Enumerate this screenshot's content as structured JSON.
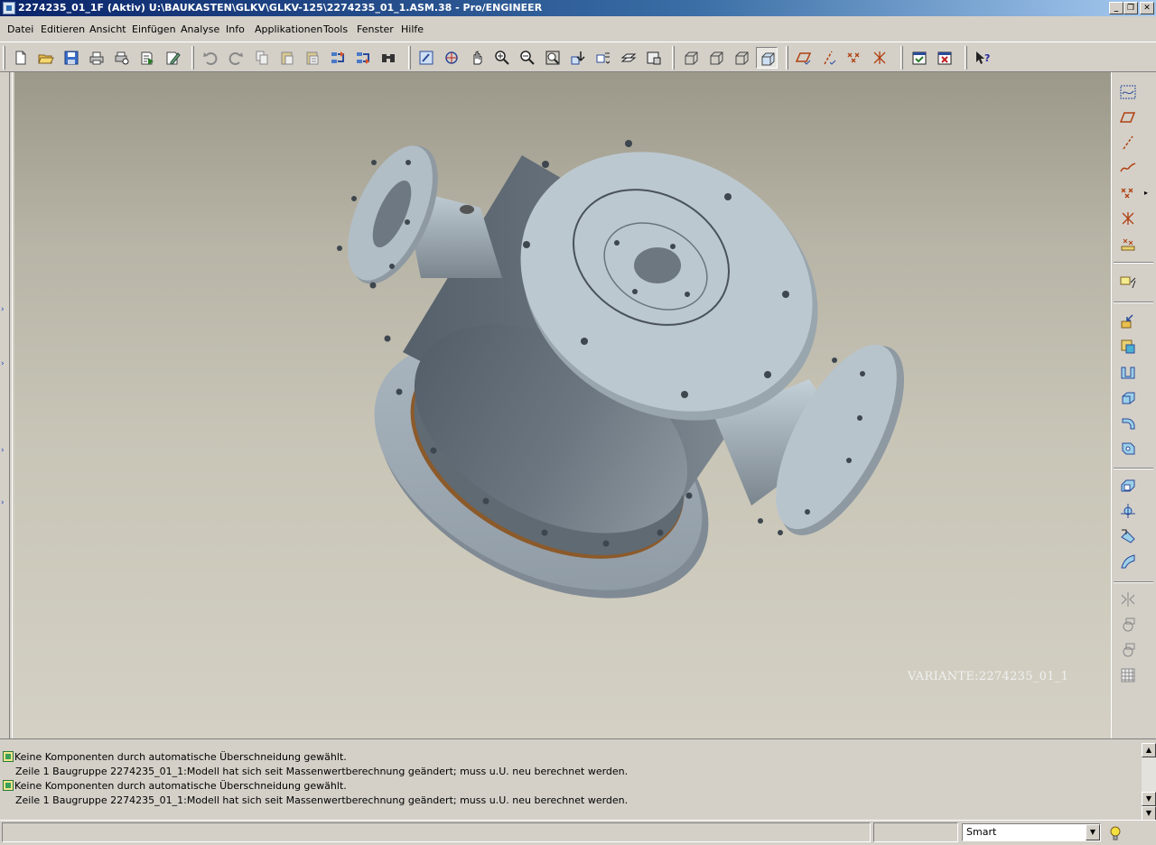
{
  "window": {
    "title": "2274235_01_1F (Aktiv) U:\\BAUKASTEN\\GLKV\\GLKV-125\\2274235_01_1.ASM.38 - Pro/ENGINEER",
    "controls": {
      "minimize": "_",
      "restore": "❐",
      "close": "✕"
    }
  },
  "menu": {
    "items": [
      {
        "label": "Datei"
      },
      {
        "label": "Editieren"
      },
      {
        "label": "Ansicht"
      },
      {
        "label": "Einfügen"
      },
      {
        "label": "Analyse"
      },
      {
        "label": "Info"
      },
      {
        "label": "Applikationen"
      },
      {
        "label": "Tools"
      },
      {
        "label": "Fenster"
      },
      {
        "label": "Hilfe"
      }
    ]
  },
  "toolbar": {
    "icons": [
      "new-file-icon",
      "open-file-icon",
      "save-icon",
      "print-icon",
      "print-preview-icon",
      "send-mail-icon",
      "edit-mail-icon",
      "undo-icon",
      "redo-icon",
      "copy-icon",
      "paste-icon",
      "paste-special-icon",
      "regenerate-icon",
      "regenerate-manager-icon",
      "find-icon",
      "repaint-icon",
      "spin-center-icon",
      "pan-icon",
      "zoom-in-icon",
      "zoom-out-icon",
      "refit-icon",
      "reorient-icon",
      "saved-views-icon",
      "layers-icon",
      "model-setup-icon",
      "wireframe-icon",
      "hidden-line-icon",
      "no-hidden-icon",
      "shading-icon",
      "datum-planes-icon",
      "datum-axes-icon",
      "datum-points-icon",
      "coordinate-systems-icon",
      "window-activate-icon",
      "window-close-icon",
      "context-help-icon"
    ]
  },
  "right_toolbar": {
    "icons": [
      "sketch-datum-curve-icon",
      "datum-plane-icon",
      "datum-axis-icon",
      "datum-curve-icon",
      "datum-point-icon",
      "datum-csys-icon",
      "analysis-feature-icon",
      "annotation-icon",
      "assemble-component-icon",
      "create-component-icon",
      "extrude-icon",
      "revolve-icon",
      "sweep-icon",
      "hole-icon",
      "shell-icon",
      "rib-icon",
      "draft-icon",
      "round-icon",
      "mirror-icon",
      "pattern-icon",
      "merge-icon",
      "table-icon"
    ]
  },
  "viewport": {
    "model_label": "VARIANTE:2274235_01_1",
    "background_top": "#9b9889",
    "background_bottom": "#d4d1c4",
    "model_color": "#b4c0c8"
  },
  "messages": [
    {
      "text": "Keine Komponenten durch automatische Überschneidung gewählt.",
      "has_icon": true
    },
    {
      "text": "Zeile 1 Baugruppe 2274235_01_1:Modell hat sich seit Massenwertberechnung geändert; muss u.U. neu berechnet werden.",
      "has_icon": false
    },
    {
      "text": "Keine Komponenten durch automatische Überschneidung gewählt.",
      "has_icon": true
    },
    {
      "text": "Zeile 1 Baugruppe 2274235_01_1:Modell hat sich seit Massenwertberechnung geändert; muss u.U. neu berechnet werden.",
      "has_icon": false
    }
  ],
  "status": {
    "filter_value": "Smart"
  }
}
